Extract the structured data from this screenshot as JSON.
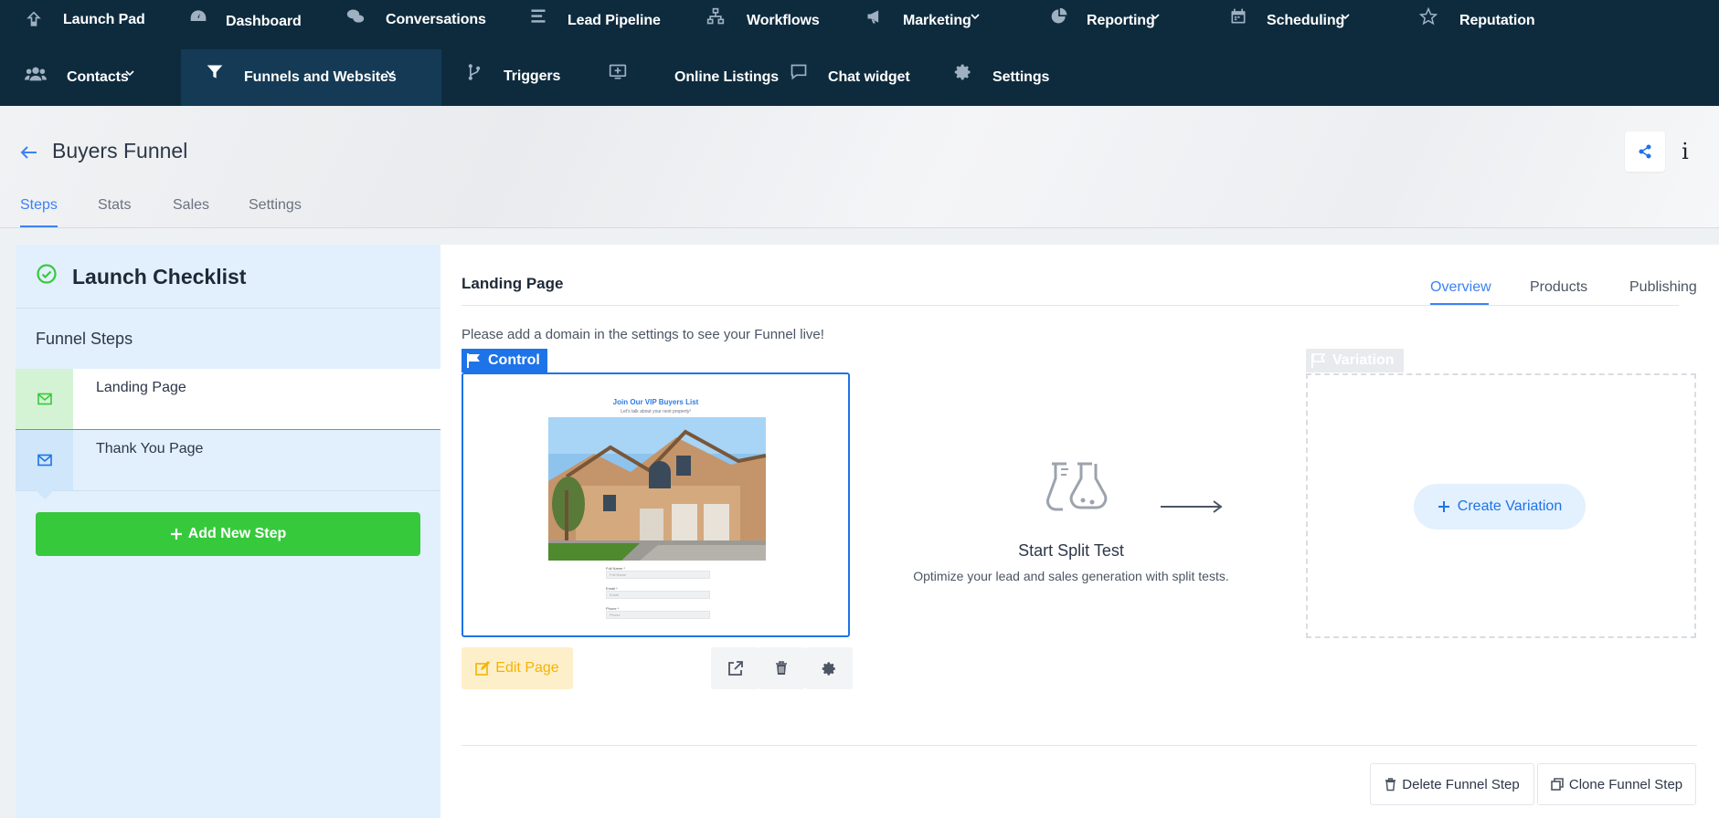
{
  "nav": {
    "row1": [
      {
        "label": "Launch Pad",
        "icon": "rocket-icon"
      },
      {
        "label": "Dashboard",
        "icon": "speedometer-icon"
      },
      {
        "label": "Conversations",
        "icon": "chat-bubbles-icon"
      },
      {
        "label": "Lead Pipeline",
        "icon": "bars-icon"
      },
      {
        "label": "Workflows",
        "icon": "sitemap-icon"
      },
      {
        "label": "Marketing",
        "icon": "megaphone-icon",
        "dropdown": true
      },
      {
        "label": "Reporting",
        "icon": "pie-chart-icon",
        "dropdown": true
      },
      {
        "label": "Scheduling",
        "icon": "calendar-icon",
        "dropdown": true
      },
      {
        "label": "Reputation",
        "icon": "star-icon"
      }
    ],
    "row2": [
      {
        "label": "Contacts",
        "icon": "users-icon",
        "dropdown": true
      },
      {
        "label": "Funnels and Websites",
        "icon": "filter-icon",
        "dropdown": true,
        "active": true
      },
      {
        "label": "Triggers",
        "icon": "branch-icon"
      },
      {
        "label": "Online Listings",
        "icon": "monitor-icon"
      },
      {
        "label": "Chat widget",
        "icon": "comment-icon"
      },
      {
        "label": "Settings",
        "icon": "gear-icon"
      }
    ]
  },
  "header": {
    "title": "Buyers Funnel",
    "tabs": [
      "Steps",
      "Stats",
      "Sales",
      "Settings"
    ],
    "active_tab": "Steps"
  },
  "sidebar": {
    "checklist_title": "Launch Checklist",
    "steps_label": "Funnel Steps",
    "steps": [
      {
        "name": "Landing Page",
        "active": true
      },
      {
        "name": "Thank You Page",
        "active": false
      }
    ],
    "add_step": "Add New Step"
  },
  "main": {
    "title": "Landing Page",
    "tabs": [
      "Overview",
      "Products",
      "Publishing"
    ],
    "active_tab": "Overview",
    "domain_note": "Please add a domain in the settings to see your Funnel live!",
    "control_label": "Control",
    "preview": {
      "heading": "Join Our VIP Buyers List",
      "subheading": "Let's talk about your next property!",
      "fields": [
        {
          "label": "Full Name *",
          "placeholder": "Full Name"
        },
        {
          "label": "Email *",
          "placeholder": "Email"
        },
        {
          "label": "Phone *",
          "placeholder": "Phone"
        }
      ]
    },
    "edit_page": "Edit Page",
    "split_test": {
      "title": "Start Split Test",
      "description": "Optimize your lead and sales generation with split tests."
    },
    "variation_label": "Variation",
    "create_variation": "Create Variation",
    "delete_step": "Delete Funnel Step",
    "clone_step": "Clone Funnel Step"
  },
  "colors": {
    "nav_bg": "#0e2b3e",
    "accent_blue": "#1e73e8",
    "success_green": "#37c93c",
    "edit_yellow": "#f5b301"
  }
}
